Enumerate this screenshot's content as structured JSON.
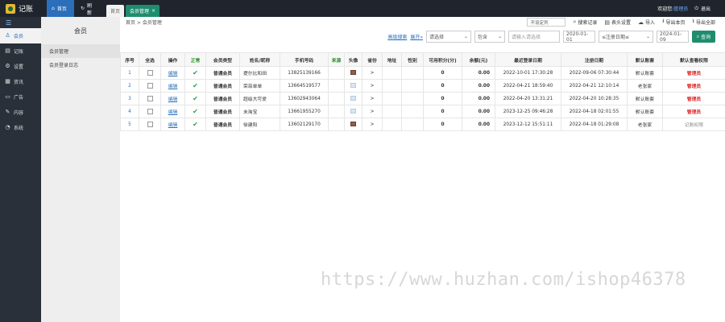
{
  "app": {
    "logo_text": "记账"
  },
  "topbar": {
    "home_label": "首页",
    "refresh_label": "刷新",
    "tabs": [
      {
        "label": "首页"
      },
      {
        "label": "会员管理",
        "close": "×"
      }
    ],
    "welcome": "欢迎您:",
    "user": "管理员",
    "logout_label": "退出"
  },
  "sidebar": {
    "menu_icon": "menu-icon",
    "items": [
      {
        "label": "会员",
        "icon": "user-icon",
        "active": true
      },
      {
        "label": "记账",
        "icon": "ledger-icon"
      },
      {
        "label": "设置",
        "icon": "gear-icon"
      },
      {
        "label": "资讯",
        "icon": "news-icon"
      },
      {
        "label": "广告",
        "icon": "ad-icon"
      },
      {
        "label": "内容",
        "icon": "content-icon"
      },
      {
        "label": "系统",
        "icon": "system-icon"
      }
    ]
  },
  "submenu": {
    "title": "会员",
    "items": [
      {
        "label": "会员管理",
        "active": true
      },
      {
        "label": "会员登录日志"
      }
    ]
  },
  "main": {
    "breadcrumb": "首页 > 会员管理",
    "toolbar": {
      "sort_select": "不设定列",
      "search_records": "搜索记录",
      "table_settings": "表头设置",
      "import": "导入",
      "export_page": "导出本页",
      "export_all": "导出全部"
    },
    "filters": {
      "advanced_search": "高级搜索",
      "expand": "展开»",
      "field_select": "请选择",
      "match_select": "包含",
      "keyword_placeholder": "请输入请选择",
      "date_from": "2020-01-01",
      "date_type": "≤注册日期≤",
      "date_to": "2024-01-09",
      "query_label": "查询"
    },
    "table": {
      "headers": [
        "序号",
        "全选",
        "操作",
        "正常",
        "会员类型",
        "姓名/昵称",
        "手机号码",
        "来源",
        "头像",
        "省份",
        "地址",
        "性别",
        "可用积分(分)",
        "余额(元)",
        "最近登录日期",
        "注册日期",
        "默认账套",
        "默认查看权限"
      ],
      "rows": [
        {
          "no": "1",
          "op": "编辑",
          "type": "普通会员",
          "name": "提尔比和田",
          "phone": "13825139166",
          "avatar": "photo",
          "province": ">",
          "points": "0",
          "balance": "0.00",
          "last_login": "2022-10-01 17:30:28",
          "reg_date": "2022-09-06 07:30:44",
          "account": "默认账套",
          "perm": "管理员",
          "perm_type": "admin"
        },
        {
          "no": "2",
          "op": "编辑",
          "type": "普通会员",
          "name": "荣菲单单",
          "phone": "13664519577",
          "avatar": "plain",
          "province": ">",
          "points": "0",
          "balance": "0.00",
          "last_login": "2022-04-21 18:59:40",
          "reg_date": "2022-04-21 12:10:14",
          "account": "老张家",
          "perm": "管理员",
          "perm_type": "admin"
        },
        {
          "no": "3",
          "op": "编辑",
          "type": "普通会员",
          "name": "超级大可爱",
          "phone": "13602943064",
          "avatar": "plain",
          "province": ">",
          "points": "0",
          "balance": "0.00",
          "last_login": "2022-04-20 13:31:21",
          "reg_date": "2022-04-20 10:28:35",
          "account": "默认账套",
          "perm": "管理员",
          "perm_type": "admin"
        },
        {
          "no": "4",
          "op": "编辑",
          "type": "普通会员",
          "name": "未淘宝",
          "phone": "13661955270",
          "avatar": "plain",
          "province": ">",
          "points": "0",
          "balance": "0.00",
          "last_login": "2023-12-25 09:46:28",
          "reg_date": "2022-04-18 02:01:55",
          "account": "默认账套",
          "perm": "管理员",
          "perm_type": "admin"
        },
        {
          "no": "5",
          "op": "编辑",
          "type": "普通会员",
          "name": "徐建阳",
          "phone": "13602129170",
          "avatar": "photo",
          "province": ">",
          "points": "0",
          "balance": "0.00",
          "last_login": "2023-12-12 15:51:11",
          "reg_date": "2022-04-18 01:29:08",
          "account": "老张家",
          "perm": "记账权限",
          "perm_type": "record"
        }
      ]
    }
  },
  "watermark": "https://www.huzhan.com/ishop46378"
}
